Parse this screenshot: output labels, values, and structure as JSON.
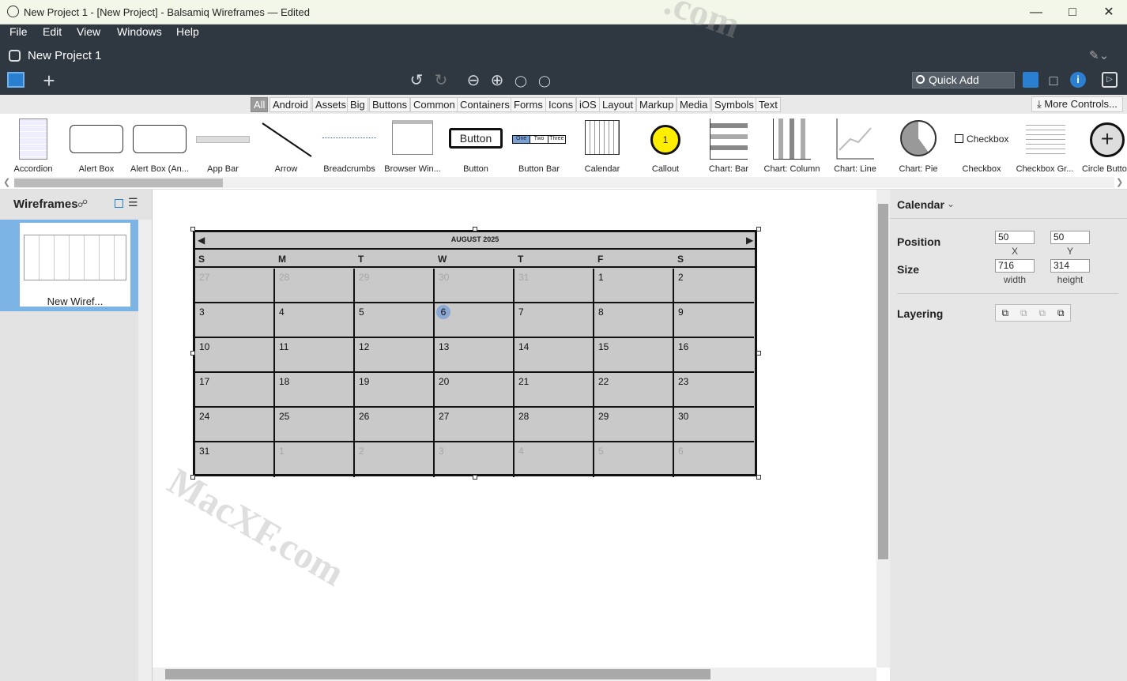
{
  "window": {
    "title": "New Project 1 - [New Project] - Balsamiq Wireframes — Edited"
  },
  "menu": [
    "File",
    "Edit",
    "View",
    "Windows",
    "Help"
  ],
  "project": {
    "name": "New Project 1"
  },
  "toolbar": {
    "quick_add": "Quick Add"
  },
  "categories": [
    "All",
    "Android",
    "Assets",
    "Big",
    "Buttons",
    "Common",
    "Containers",
    "Forms",
    "Icons",
    "iOS",
    "Layout",
    "Markup",
    "Media",
    "Symbols",
    "Text"
  ],
  "more_controls": "More Controls...",
  "library": [
    "Accordion",
    "Alert Box",
    "Alert Box (An...",
    "App Bar",
    "Arrow",
    "Breadcrumbs",
    "Browser Win...",
    "Button",
    "Button Bar",
    "Calendar",
    "Callout",
    "Chart: Bar",
    "Chart: Column",
    "Chart: Line",
    "Chart: Pie",
    "Checkbox",
    "Checkbox Gr...",
    "Circle Butto..."
  ],
  "library_thumbs": {
    "button": "Button",
    "button_bar": [
      "One",
      "Two",
      "Three"
    ],
    "callout": "1",
    "checkbox": "Checkbox"
  },
  "left_panel": {
    "title": "Wireframes",
    "wireframe_name": "New Wiref..."
  },
  "right_panel": {
    "title": "Calendar",
    "position_label": "Position",
    "size_label": "Size",
    "layering_label": "Layering",
    "x": "50",
    "y": "50",
    "x_label": "X",
    "y_label": "Y",
    "width": "716",
    "height": "314",
    "width_label": "width",
    "height_label": "height"
  },
  "calendar": {
    "month": "AUGUST 2025",
    "weekdays": [
      "S",
      "M",
      "T",
      "W",
      "T",
      "F",
      "S"
    ],
    "cells": [
      [
        "27",
        "28",
        "29",
        "30",
        "31",
        "1",
        "2"
      ],
      [
        "3",
        "4",
        "5",
        "6",
        "7",
        "8",
        "9"
      ],
      [
        "10",
        "11",
        "12",
        "13",
        "14",
        "15",
        "16"
      ],
      [
        "17",
        "18",
        "19",
        "20",
        "21",
        "22",
        "23"
      ],
      [
        "24",
        "25",
        "26",
        "27",
        "28",
        "29",
        "30"
      ],
      [
        "31",
        "1",
        "2",
        "3",
        "4",
        "5",
        "6"
      ]
    ],
    "dim_first_row": 5,
    "dim_last_row_from": 1,
    "today": "6"
  },
  "watermark": [
    "MacXF.com",
    ".com"
  ]
}
